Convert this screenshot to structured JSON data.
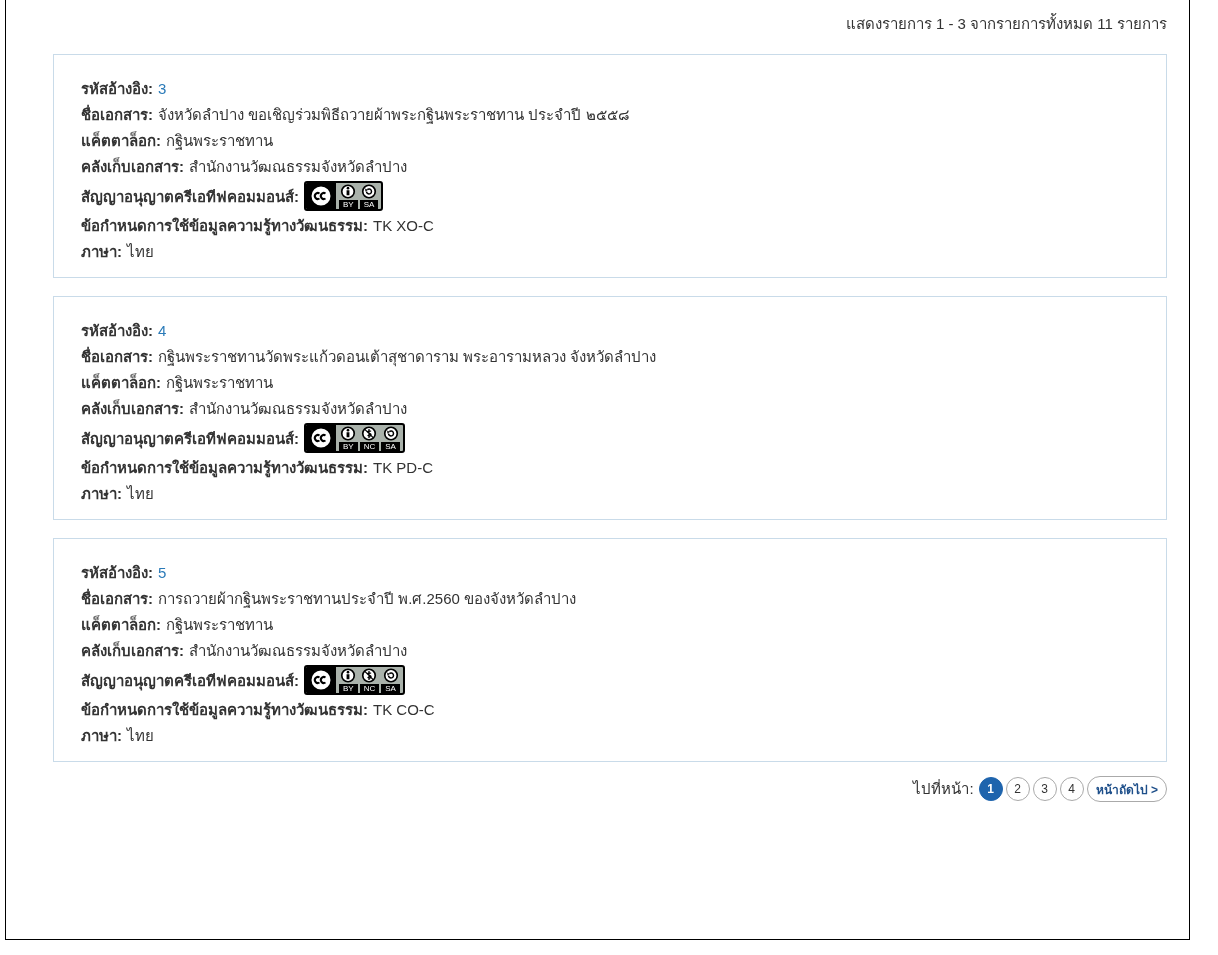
{
  "summary": "แสดงรายการ 1 - 3 จากรายการทั้งหมด 11 รายการ",
  "records": [
    {
      "fields": [
        {
          "kind": "link",
          "label": "รหัสอ้างอิง:",
          "value": "3"
        },
        {
          "kind": "text",
          "label": "ชื่อเอกสาร:",
          "value": "จังหวัดลำปาง ขอเชิญร่วมพิธีถวายผ้าพระกฐินพระราชทาน ประจำปี ๒๕๕๘"
        },
        {
          "kind": "text",
          "label": "แค็ตตาล็อก:",
          "value": "กฐินพระราชทาน"
        },
        {
          "kind": "text",
          "label": "คลังเก็บเอกสาร:",
          "value": "สำนักงานวัฒณธรรมจังหวัดลำปาง"
        },
        {
          "kind": "license",
          "label": "สัญญาอนุญาตครีเอทีฟคอมมอนส์:",
          "terms": [
            {
              "kind": "by",
              "label": "BY"
            },
            {
              "kind": "sa",
              "label": "SA"
            }
          ]
        },
        {
          "kind": "text",
          "label": "ข้อกำหนดการใช้ข้อมูลความรู้ทางวัฒนธรรม:",
          "value": "TK XO-C"
        },
        {
          "kind": "text",
          "label": "ภาษา:",
          "value": "ไทย"
        }
      ]
    },
    {
      "fields": [
        {
          "kind": "link",
          "label": "รหัสอ้างอิง:",
          "value": "4"
        },
        {
          "kind": "text",
          "label": "ชื่อเอกสาร:",
          "value": "กฐินพระราชทานวัดพระแก้วดอนเต้าสุชาดาราม พระอารามหลวง จังหวัดลำปาง"
        },
        {
          "kind": "text",
          "label": "แค็ตตาล็อก:",
          "value": "กฐินพระราชทาน"
        },
        {
          "kind": "text",
          "label": "คลังเก็บเอกสาร:",
          "value": "สำนักงานวัฒณธรรมจังหวัดลำปาง"
        },
        {
          "kind": "license",
          "label": "สัญญาอนุญาตครีเอทีฟคอมมอนส์:",
          "terms": [
            {
              "kind": "by",
              "label": "BY"
            },
            {
              "kind": "nc",
              "label": "NC"
            },
            {
              "kind": "sa",
              "label": "SA"
            }
          ]
        },
        {
          "kind": "text",
          "label": "ข้อกำหนดการใช้ข้อมูลความรู้ทางวัฒนธรรม:",
          "value": "TK PD-C"
        },
        {
          "kind": "text",
          "label": "ภาษา:",
          "value": "ไทย"
        }
      ]
    },
    {
      "fields": [
        {
          "kind": "link",
          "label": "รหัสอ้างอิง:",
          "value": "5"
        },
        {
          "kind": "text",
          "label": "ชื่อเอกสาร:",
          "value": "การถวายผ้ากฐินพระราชทานประจำปี พ.ศ.2560 ของจังหวัดลำปาง"
        },
        {
          "kind": "text",
          "label": "แค็ตตาล็อก:",
          "value": "กฐินพระราชทาน"
        },
        {
          "kind": "text",
          "label": "คลังเก็บเอกสาร:",
          "value": "สำนักงานวัฒณธรรมจังหวัดลำปาง"
        },
        {
          "kind": "license",
          "label": "สัญญาอนุญาตครีเอทีฟคอมมอนส์:",
          "terms": [
            {
              "kind": "by",
              "label": "BY"
            },
            {
              "kind": "nc",
              "label": "NC"
            },
            {
              "kind": "sa",
              "label": "SA"
            }
          ]
        },
        {
          "kind": "text",
          "label": "ข้อกำหนดการใช้ข้อมูลความรู้ทางวัฒนธรรม:",
          "value": "TK CO-C"
        },
        {
          "kind": "text",
          "label": "ภาษา:",
          "value": "ไทย"
        }
      ]
    }
  ],
  "pagination": {
    "label": "ไปที่หน้า:",
    "pages": [
      {
        "label": "1",
        "selected": true
      },
      {
        "label": "2",
        "selected": false
      },
      {
        "label": "3",
        "selected": false
      },
      {
        "label": "4",
        "selected": false
      }
    ],
    "next": "หน้าถัดไป >"
  }
}
